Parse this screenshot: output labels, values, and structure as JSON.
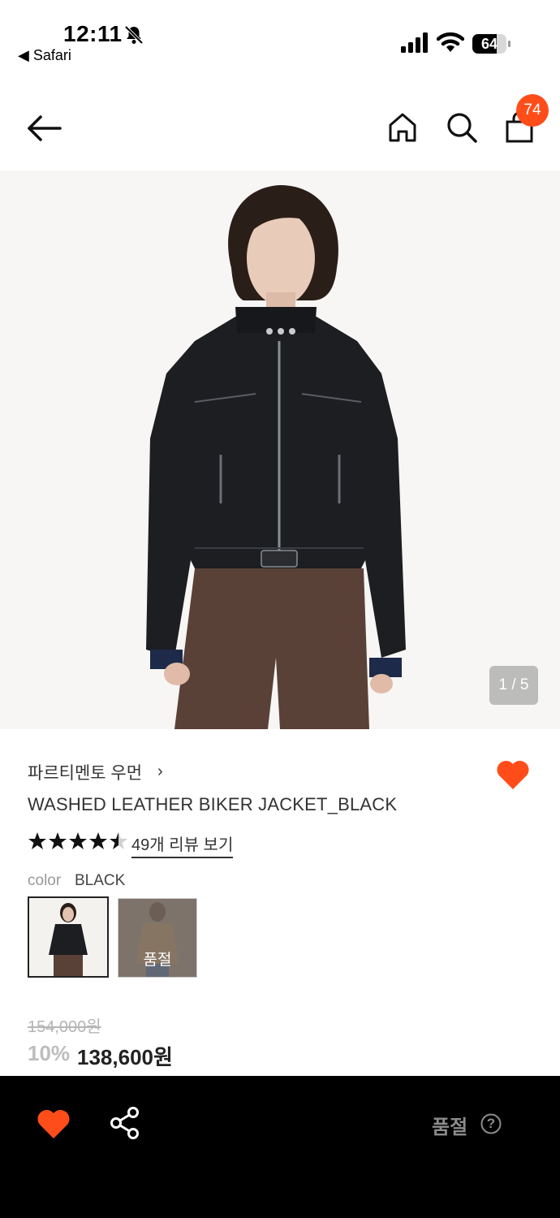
{
  "status_bar": {
    "time": "12:11",
    "back_app_label": "◀ Safari",
    "battery_level": "64",
    "icons": [
      "bell-off-icon",
      "signal-icon",
      "wifi-icon",
      "battery-icon"
    ]
  },
  "nav": {
    "icons": [
      "arrow-left-icon",
      "home-icon",
      "search-icon",
      "shopping-bag-icon"
    ],
    "cart_badge": "74",
    "accent_color": "#ff4d1a"
  },
  "hero": {
    "image_counter": "1 / 5",
    "current_image": 1,
    "total_images": 5
  },
  "product": {
    "brand": "파르티멘토 우먼",
    "brand_chevron": "›",
    "name": "WASHED LEATHER BIKER JACKET_BLACK",
    "rating": 4.5,
    "review_link": "49개 리뷰 보기",
    "color_label": "color",
    "color_value": "BLACK",
    "swatches": [
      {
        "color": "BLACK",
        "selected": true,
        "sold_out": false
      },
      {
        "color": "BROWN",
        "selected": false,
        "sold_out": true,
        "label": "품절"
      }
    ],
    "original_price": "154,000원",
    "discount": "10%",
    "sale_price": "138,600원",
    "wishlisted": true
  },
  "bottom_bar": {
    "icons": [
      "heart-icon",
      "share-icon",
      "help-circle-icon"
    ],
    "status_label": "품절",
    "help_symbol": "?"
  }
}
